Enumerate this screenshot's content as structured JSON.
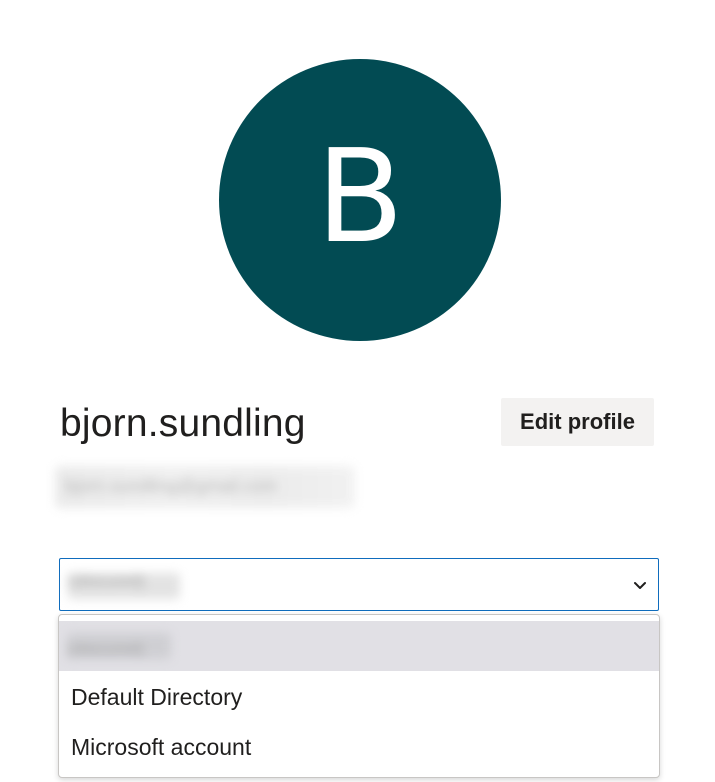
{
  "profile": {
    "avatar_initial": "B",
    "avatar_color": "#024b53",
    "username": "bjorn.sundling",
    "edit_button_label": "Edit profile",
    "email": "bjorn.sundling@gmail.com"
  },
  "directory_select": {
    "selected_value": "(obscured)",
    "chevron_icon": "chevron-down-icon",
    "accent_color": "#0f6cbd",
    "options": [
      {
        "label": "(obscured)",
        "selected": true
      },
      {
        "label": "Default Directory",
        "selected": false
      },
      {
        "label": "Microsoft account",
        "selected": false
      }
    ]
  }
}
